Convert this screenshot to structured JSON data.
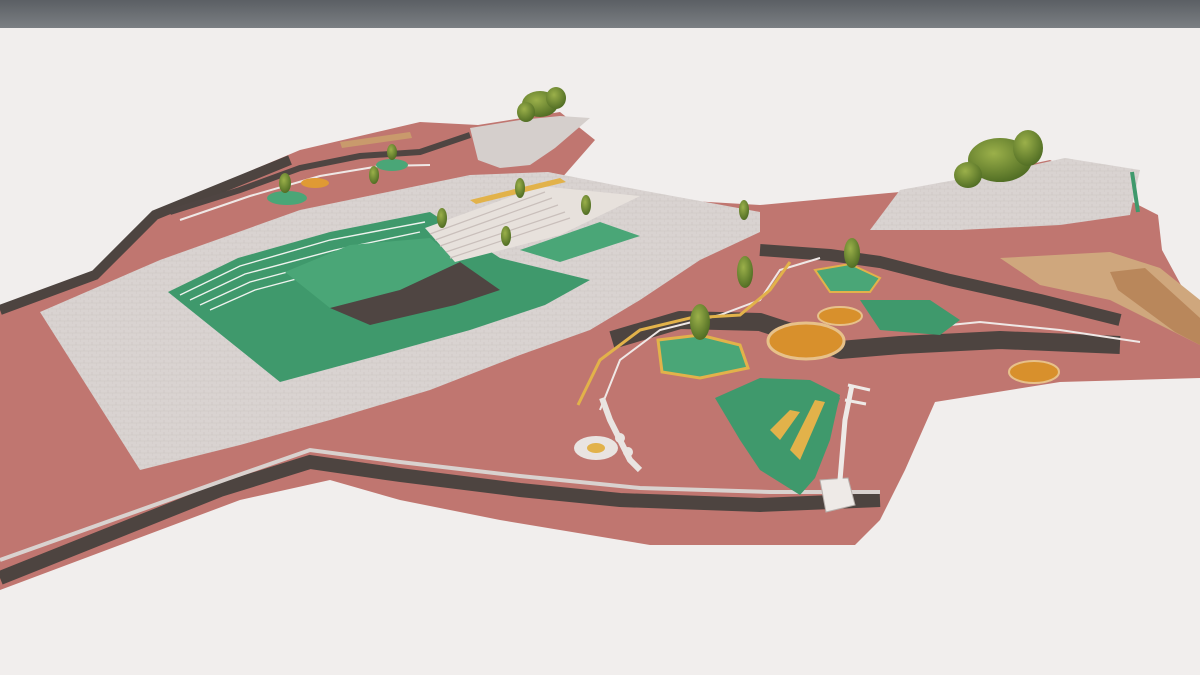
{
  "scene": {
    "description_visible_text": "",
    "colors": {
      "sky_top": "#5f6469",
      "ground": "#f1eeed",
      "red_surface": "#c2776f",
      "dark_path": "#4f4542",
      "pavers": "#d8d2d0",
      "green_court": "#3f9a6d",
      "track_lines": "#f4f1ee",
      "yellow": "#e2b24a",
      "orange_circle": "#e09a34",
      "tree_green": "#6a8a2c",
      "wood": "#c99a6c"
    }
  }
}
